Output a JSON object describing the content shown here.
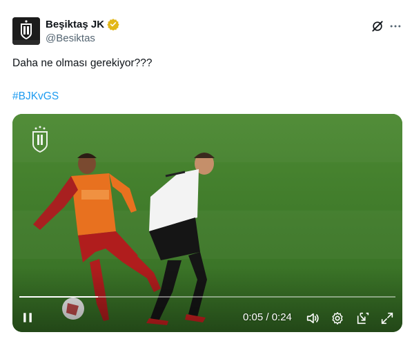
{
  "post": {
    "display_name": "Beşiktaş JK",
    "handle": "@Besiktas",
    "text": "Daha ne olması gerekiyor???",
    "hashtag": "#BJKvGS",
    "verified_color": "#e2b719"
  },
  "avatar": {
    "logo_text": "BJK"
  },
  "video": {
    "current_time": "0:05",
    "duration": "0:24",
    "time_display": "0:05 / 0:24",
    "progress": 0.21,
    "watermark_icon": "besiktas-crest-icon"
  },
  "icons": {
    "grok": "grok-icon",
    "more": "more-icon",
    "pause": "pause-icon",
    "volume": "volume-icon",
    "settings": "settings-icon",
    "popout": "popout-icon",
    "fullscreen": "fullscreen-icon"
  },
  "colors": {
    "hashtag": "#1d9bf0",
    "handle": "#536471",
    "pitch": "#3f7a2a"
  }
}
